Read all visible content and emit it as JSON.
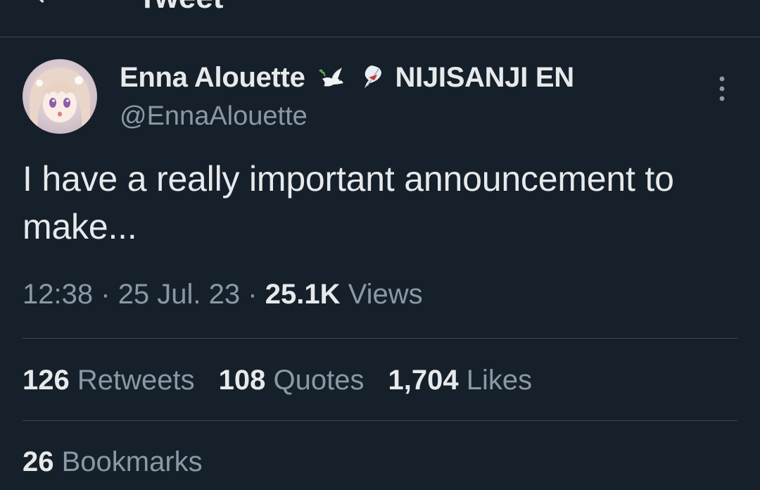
{
  "header": {
    "title": "Tweet"
  },
  "tweet": {
    "author_name": "Enna Alouette",
    "affiliation": "NIJISANJI EN",
    "name_emojis": [
      "dove-icon",
      "feather-quill-icon"
    ],
    "handle": "@EnnaAlouette",
    "text": "I have a really important announcement to make...",
    "time": "12:38",
    "date": "25 Jul. 23",
    "views_count": "25.1K",
    "views_label": "Views",
    "separator": "·"
  },
  "stats": {
    "retweets_count": "126",
    "retweets_label": "Retweets",
    "quotes_count": "108",
    "quotes_label": "Quotes",
    "likes_count": "1,704",
    "likes_label": "Likes",
    "bookmarks_count": "26",
    "bookmarks_label": "Bookmarks"
  },
  "colors": {
    "background": "#15202b",
    "primary_text": "#e7e9ea",
    "secondary_text": "#8b98a5",
    "divider": "#38444d"
  }
}
